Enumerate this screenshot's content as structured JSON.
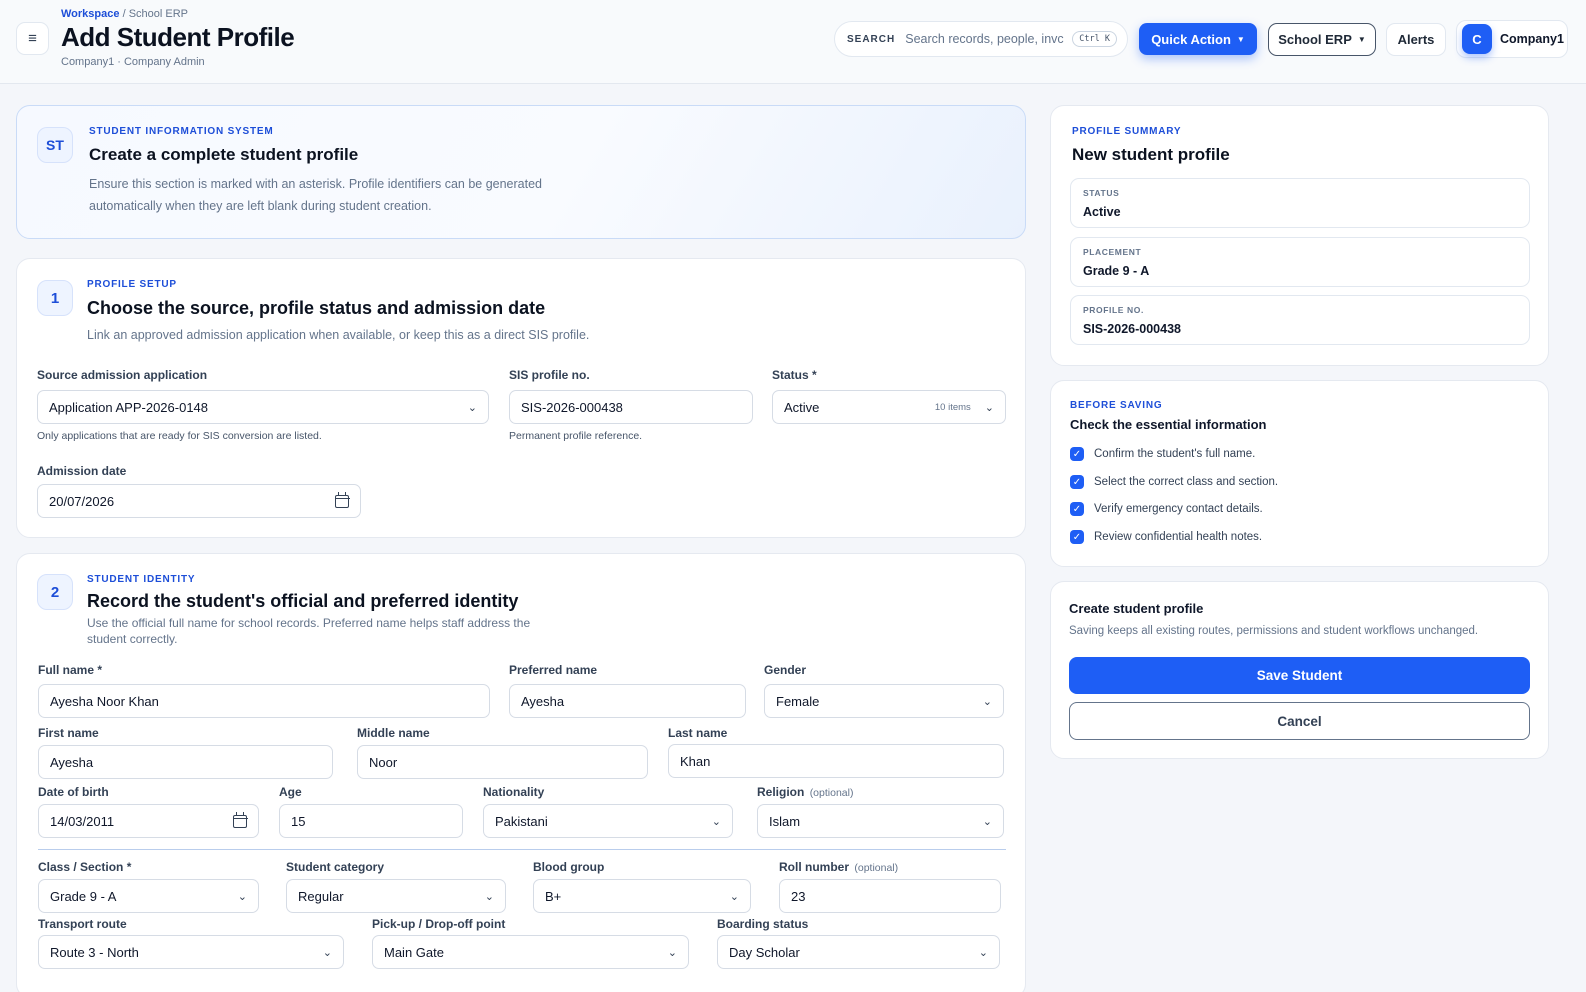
{
  "header": {
    "breadcrumb_root": "Workspace",
    "breadcrumb_sep": "/",
    "breadcrumb_current": "School ERP",
    "title": "Add Student Profile",
    "subtitle": "Company1 · Company Admin",
    "menu_icon": "≡",
    "search_label": "SEARCH",
    "search_placeholder": "Search records, people, invc",
    "search_shortcut": "Ctrl K",
    "quick_action": "Quick Action",
    "erp_menu": "School ERP",
    "alerts": "Alerts",
    "avatar_initial": "C",
    "company": "Company1"
  },
  "intro": {
    "badge": "ST",
    "eyebrow": "STUDENT INFORMATION SYSTEM",
    "title": "Create a complete student profile",
    "desc_line1": "Ensure this section is marked with an asterisk. Profile identifiers can be generated",
    "desc_line2": "automatically when they are left blank during student creation."
  },
  "section1": {
    "number": "1",
    "eyebrow": "PROFILE SETUP",
    "title": "Choose the source, profile status and admission date",
    "desc": "Link an approved admission application when available, or keep this as a direct SIS profile.",
    "source_label": "Source admission application",
    "source_value": "Application APP-2026-0148",
    "source_hint": "Only applications that are ready for SIS conversion are listed.",
    "profile_no_label": "SIS profile no.",
    "profile_no_value": "SIS-2026-000438",
    "profile_no_hint": "Permanent profile reference.",
    "status_label": "Status *",
    "status_value": "Active",
    "status_items": "10 items",
    "admission_label": "Admission date",
    "admission_value": "20/07/2026"
  },
  "section2": {
    "number": "2",
    "eyebrow": "STUDENT IDENTITY",
    "title": "Record the student's official and preferred identity",
    "desc_line1": "Use the official full name for school records. Preferred name helps staff address the",
    "desc_line2": "student correctly.",
    "full_name_label": "Full name *",
    "full_name": "Ayesha Noor Khan",
    "preferred_label": "Preferred name",
    "preferred": "Ayesha",
    "gender_label": "Gender",
    "gender": "Female",
    "first_label": "First name",
    "first": "Ayesha",
    "middle_label": "Middle name",
    "middle": "Noor",
    "last_label": "Last name",
    "last": "Khan",
    "dob_label": "Date of birth",
    "dob": "14/03/2011",
    "age_label": "Age",
    "age": "15",
    "nationality_label": "Nationality",
    "nationality": "Pakistani",
    "religion_label": "Religion",
    "optional": "(optional)",
    "religion": "Islam",
    "class_label": "Class / Section *",
    "class": "Grade 9 - A",
    "category_label": "Student category",
    "category": "Regular",
    "blood_label": "Blood group",
    "blood": "B+",
    "roll_label": "Roll number",
    "roll": "23",
    "transport_label": "Transport route",
    "transport": "Route 3 - North",
    "pickup_label": "Pick-up / Drop-off point",
    "pickup": "Main Gate",
    "boarding_label": "Boarding status",
    "boarding": "Day Scholar"
  },
  "summary": {
    "eyebrow": "PROFILE SUMMARY",
    "title": "New student profile",
    "status_key": "STATUS",
    "status_val": "Active",
    "placement_key": "PLACEMENT",
    "placement_val": "Grade 9 - A",
    "profile_key": "PROFILE NO.",
    "profile_val": "SIS-2026-000438"
  },
  "checklist": {
    "eyebrow": "BEFORE SAVING",
    "title": "Check the essential information",
    "items": [
      "Confirm the student's full name.",
      "Select the correct class and section.",
      "Verify emergency contact details.",
      "Review confidential health notes."
    ]
  },
  "actions": {
    "title": "Create student profile",
    "desc": "Saving keeps all existing routes, permissions and student workflows unchanged.",
    "save": "Save Student",
    "cancel": "Cancel"
  },
  "colors": {
    "accent": "#1e5ef5",
    "eyebrow": "#1d4ed8",
    "page_bg": "#f4f6fa"
  }
}
